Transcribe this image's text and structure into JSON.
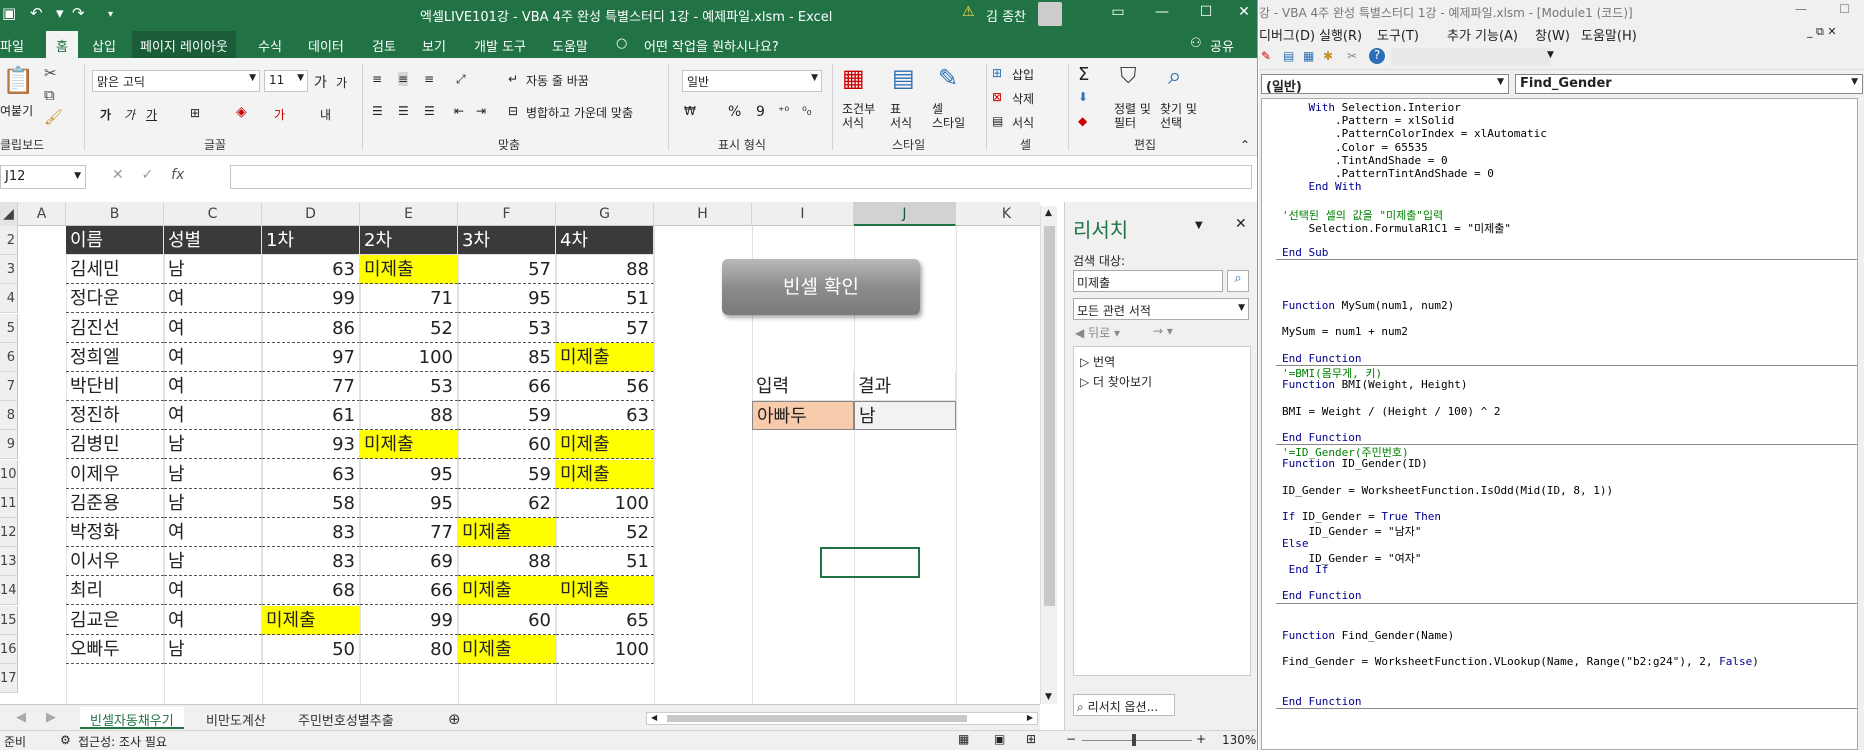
{
  "excel": {
    "title": "엑셀LIVE101강 - VBA 4주 완성 특별스터디 1강 - 예제파일.xlsm  -  Excel",
    "user": "김 종찬",
    "tabs": [
      "파일",
      "홈",
      "삽입",
      "페이지 레이아웃",
      "수식",
      "데이터",
      "검토",
      "보기",
      "개발 도구",
      "도움말",
      "어떤 작업을 원하시나요?",
      "공유"
    ],
    "ribbon": {
      "clipboard": {
        "paste": "여붙기",
        "group": "클립보드"
      },
      "font": {
        "name": "맑은 고딕",
        "size": "11",
        "group": "글꼴"
      },
      "align": {
        "wrap": "자동 줄 바꿈",
        "merge": "병합하고 가운데 맞춤",
        "group": "맞춤"
      },
      "number": {
        "format": "일반",
        "group": "표시 형식"
      },
      "styles": {
        "cond": "조건부\n서식",
        "table": "표\n서식",
        "cell": "셀\n스타일",
        "group": "스타일"
      },
      "cells": {
        "insert": "삽입",
        "delete": "삭제",
        "format": "서식",
        "group": "셀"
      },
      "edit": {
        "sort": "정렬 및\n필터",
        "find": "찾기 및\n선택",
        "group": "편집"
      }
    },
    "namebox": "J12",
    "columns": [
      "A",
      "B",
      "C",
      "D",
      "E",
      "F",
      "G",
      "H",
      "I",
      "J",
      "K"
    ],
    "rows": [
      "2",
      "3",
      "4",
      "5",
      "6",
      "7",
      "8",
      "9",
      "10",
      "11",
      "12",
      "13",
      "14",
      "15",
      "16",
      "17"
    ],
    "header_row": [
      "이름",
      "성별",
      "1차",
      "2차",
      "3차",
      "4차"
    ],
    "data": [
      [
        "김세민",
        "남",
        "63",
        "미제출",
        "57",
        "88"
      ],
      [
        "정다운",
        "여",
        "99",
        "71",
        "95",
        "51"
      ],
      [
        "김진선",
        "여",
        "86",
        "52",
        "53",
        "57"
      ],
      [
        "정희엘",
        "여",
        "97",
        "100",
        "85",
        "미제출"
      ],
      [
        "박단비",
        "여",
        "77",
        "53",
        "66",
        "56"
      ],
      [
        "정진하",
        "여",
        "61",
        "88",
        "59",
        "63"
      ],
      [
        "김병민",
        "남",
        "93",
        "미제출",
        "60",
        "미제출"
      ],
      [
        "이제우",
        "남",
        "63",
        "95",
        "59",
        "미제출"
      ],
      [
        "김준용",
        "남",
        "58",
        "95",
        "62",
        "100"
      ],
      [
        "박정화",
        "여",
        "83",
        "77",
        "미제출",
        "52"
      ],
      [
        "이서우",
        "남",
        "83",
        "69",
        "88",
        "51"
      ],
      [
        "최리",
        "여",
        "68",
        "66",
        "미제출",
        "미제출"
      ],
      [
        "김교은",
        "여",
        "미제출",
        "99",
        "60",
        "65"
      ],
      [
        "오빠두",
        "남",
        "50",
        "80",
        "미제출",
        "100"
      ]
    ],
    "button_label": "빈셀 확인",
    "lookup": {
      "input_label": "입력",
      "result_label": "결과",
      "input_value": "아빠두",
      "result_value": "남"
    },
    "research": {
      "title": "리서치",
      "search_for": "검색 대상:",
      "query": "미제출",
      "scope": "모든 관련 서적",
      "back": "뒤로",
      "items": [
        "번역",
        "더 찾아보기"
      ],
      "options": "리서치 옵션..."
    },
    "sheets": [
      "빈셀자동채우기",
      "비만도계산",
      "주민번호성별추출"
    ],
    "status": {
      "ready": "준비",
      "access": "접근성: 조사 필요",
      "zoom": "130%"
    }
  },
  "vbe": {
    "title": "강 - VBA 4주 완성 특별스터디 1강 - 예제파일.xlsm - [Module1 (코드)]",
    "menus": [
      "디버그(D)",
      "실행(R)",
      "도구(T)",
      "추가 기능(A)",
      "창(W)",
      "도움말(H)"
    ],
    "object": "(일반)",
    "procedure": "Find_Gender",
    "code": [
      "    With Selection.Interior",
      "        .Pattern = xlSolid",
      "        .PatternColorIndex = xlAutomatic",
      "        .Color = 65535",
      "        .TintAndShade = 0",
      "        .PatternTintAndShade = 0",
      "    End With",
      "",
      "'선택된 셀의 값을 \"미제출\"입력",
      "    Selection.FormulaR1C1 = \"미제출\"",
      "",
      "End Sub",
      "",
      "",
      "",
      "Function MySum(num1, num2)",
      "",
      "MySum = num1 + num2",
      "",
      "End Function",
      "'=BMI(몸무게, 키)",
      "Function BMI(Weight, Height)",
      "",
      "BMI = Weight / (Height / 100) ^ 2",
      "",
      "End Function",
      "'=ID_Gender(주민번호)",
      "Function ID_Gender(ID)",
      "",
      "ID_Gender = WorksheetFunction.IsOdd(Mid(ID, 8, 1))",
      "",
      "If ID_Gender = True Then",
      "    ID_Gender = \"남자\"",
      "Else",
      "    ID_Gender = \"여자\"",
      " End If",
      "",
      "End Function",
      "",
      "",
      "Function Find_Gender(Name)",
      "",
      "Find_Gender = WorksheetFunction.VLookup(Name, Range(\"b2:g24\"), 2, False)",
      "",
      "",
      "End Function"
    ]
  },
  "colors": {
    "excel_green": "#217346",
    "highlight": "#ffff00",
    "header_dark": "#3a3a3a",
    "input_fill": "#f8cbad"
  }
}
